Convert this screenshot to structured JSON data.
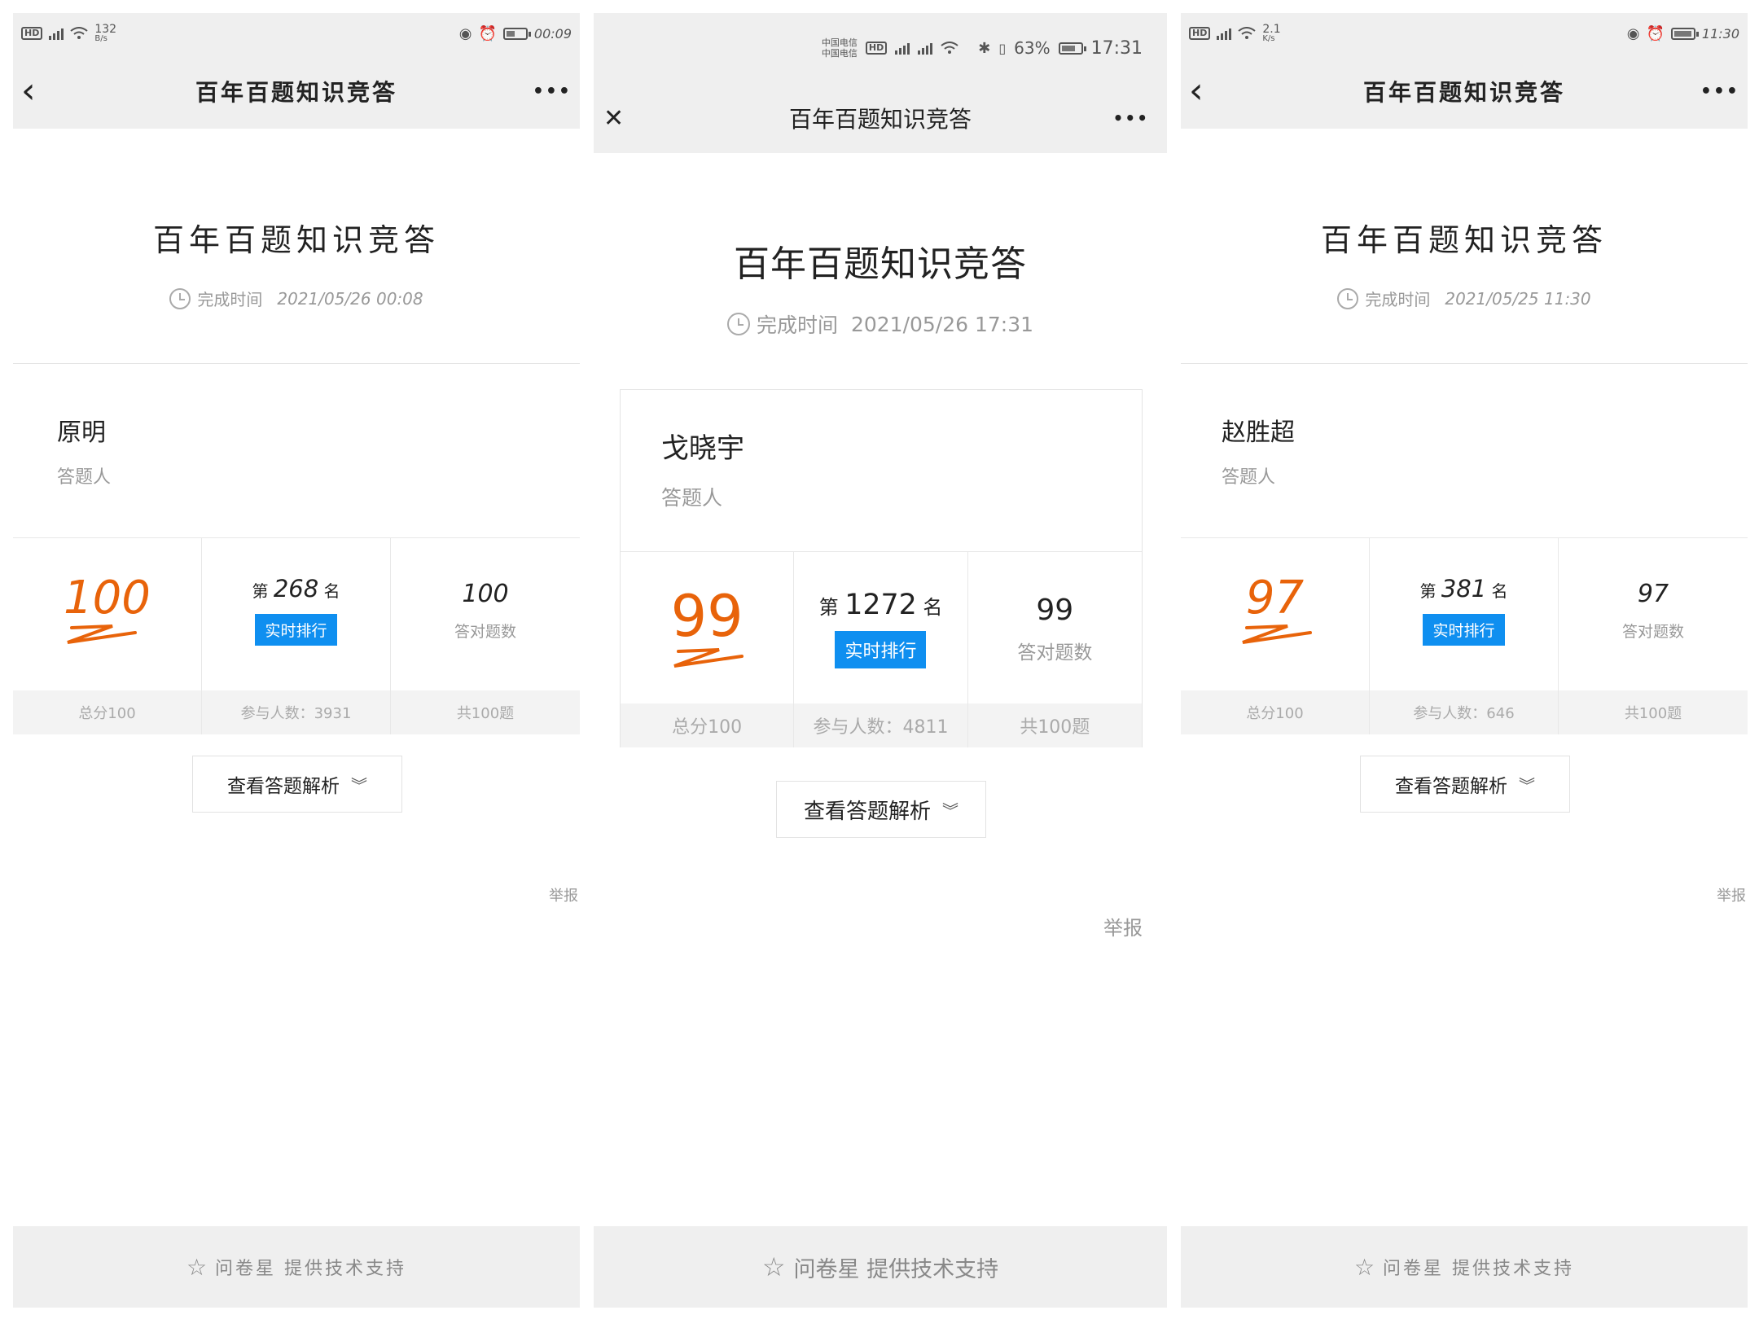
{
  "app": {
    "nav_title": "百年百题知识竞答",
    "more_label": "•••",
    "back_glyph": "‹",
    "close_glyph": "✕"
  },
  "colors": {
    "score": "#e8630a",
    "rank_button": "#0f8ff0",
    "bar_bg": "#efefef"
  },
  "screens": [
    {
      "status": {
        "left_net": "4G",
        "speed_top": "132",
        "speed_unit": "B/s",
        "time": "00:09",
        "battery_fraction": 0.4
      },
      "nav_left_icon": "back-icon",
      "survey_title": "百年百题知识竞答",
      "time_label": "完成时间",
      "time_value": "2021/05/26 00:08",
      "person_name": "原明",
      "person_role": "答题人",
      "score": "100",
      "rank_prefix": "第",
      "rank_number": "268",
      "rank_suffix": "名",
      "rank_button": "实时排行",
      "correct_count": "100",
      "correct_label": "答对题数",
      "total_label": "总分100",
      "participants": "参与人数：3931",
      "question_count": "共100题",
      "view_analysis": "查看答题解析",
      "report": "举报",
      "footer": "问卷星 提供技术支持"
    },
    {
      "status": {
        "carrier_top": "中国电信",
        "carrier_bottom": "中国电信",
        "battery_text": "63%",
        "time": "17:31",
        "battery_fraction": 0.63
      },
      "nav_left_icon": "close-icon",
      "survey_title": "百年百题知识竞答",
      "time_label": "完成时间",
      "time_value": "2021/05/26 17:31",
      "person_name": "戈晓宇",
      "person_role": "答题人",
      "score": "99",
      "rank_prefix": "第",
      "rank_number": "1272",
      "rank_suffix": "名",
      "rank_button": "实时排行",
      "correct_count": "99",
      "correct_label": "答对题数",
      "total_label": "总分100",
      "participants": "参与人数：4811",
      "question_count": "共100题",
      "view_analysis": "查看答题解析",
      "report": "举报",
      "footer": "问卷星 提供技术支持"
    },
    {
      "status": {
        "left_net": "4G",
        "speed_top": "2.1",
        "speed_unit": "K/s",
        "time": "11:30",
        "battery_fraction": 0.8
      },
      "nav_left_icon": "back-icon",
      "survey_title": "百年百题知识竞答",
      "time_label": "完成时间",
      "time_value": "2021/05/25 11:30",
      "person_name": "赵胜超",
      "person_role": "答题人",
      "score": "97",
      "rank_prefix": "第",
      "rank_number": "381",
      "rank_suffix": "名",
      "rank_button": "实时排行",
      "correct_count": "97",
      "correct_label": "答对题数",
      "total_label": "总分100",
      "participants": "参与人数：646",
      "question_count": "共100题",
      "view_analysis": "查看答题解析",
      "report": "举报",
      "footer": "问卷星 提供技术支持"
    }
  ]
}
